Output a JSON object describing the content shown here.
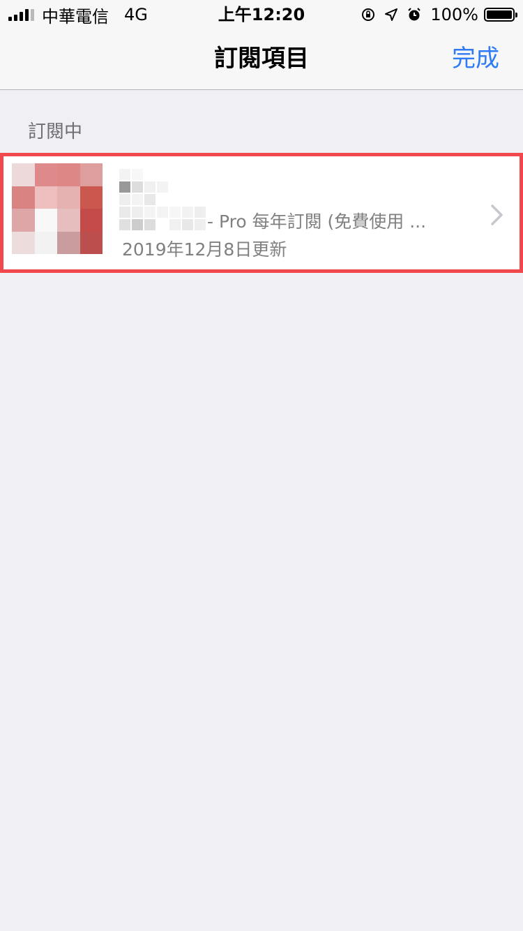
{
  "status_bar": {
    "carrier": "中華電信",
    "network": "4G",
    "time": "上午12:20",
    "battery": "100%"
  },
  "nav": {
    "title": "訂閱項目",
    "done_label": "完成"
  },
  "section": {
    "header": "訂閱中"
  },
  "subscription": {
    "name": "- Pro 每年訂閱 (免費使用 ...",
    "updated": "2019年12月8日更新"
  },
  "colors": {
    "accent": "#2f7bf5",
    "highlight_border": "#f1484d",
    "background": "#efeff4"
  }
}
